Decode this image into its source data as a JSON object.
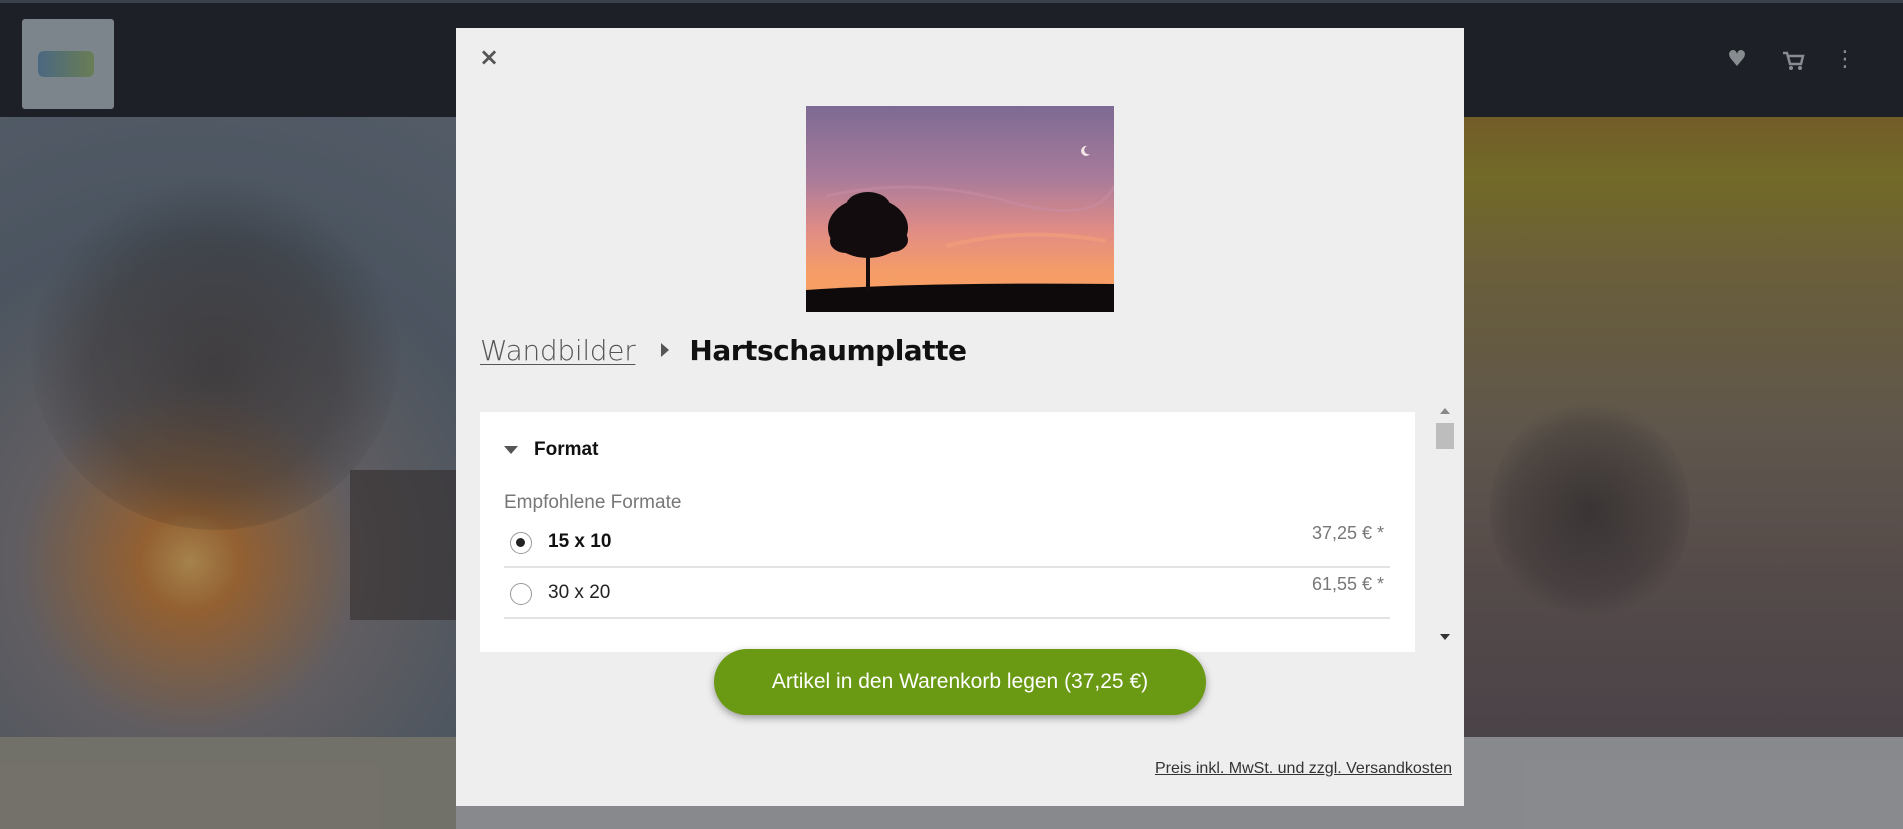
{
  "modal": {
    "close_label": "×",
    "breadcrumb": {
      "parent": "Wandbilder",
      "current": "Hartschaumplatte"
    },
    "format_section": {
      "title": "Format",
      "subtitle": "Empfohlene Formate",
      "options": [
        {
          "label": "15 x 10",
          "price": "37,25 € *",
          "selected": true
        },
        {
          "label": "30 x 20",
          "price": "61,55 € *",
          "selected": false
        }
      ]
    },
    "add_to_cart_label": "Artikel in den Warenkorb legen (37,25 €)",
    "price_note": "Preis inkl. MwSt. und zzgl. Versandkosten"
  },
  "colors": {
    "accent_green": "#6a9a14",
    "modal_bg": "#eeeeee",
    "panel_bg": "#ffffff"
  },
  "icons": {
    "close": "close-icon",
    "breadcrumb_separator": "chevron-right-icon",
    "section_toggle": "caret-down-icon",
    "header_wishlist": "heart-icon",
    "header_cart": "cart-icon",
    "header_menu": "menu-dots-icon"
  }
}
